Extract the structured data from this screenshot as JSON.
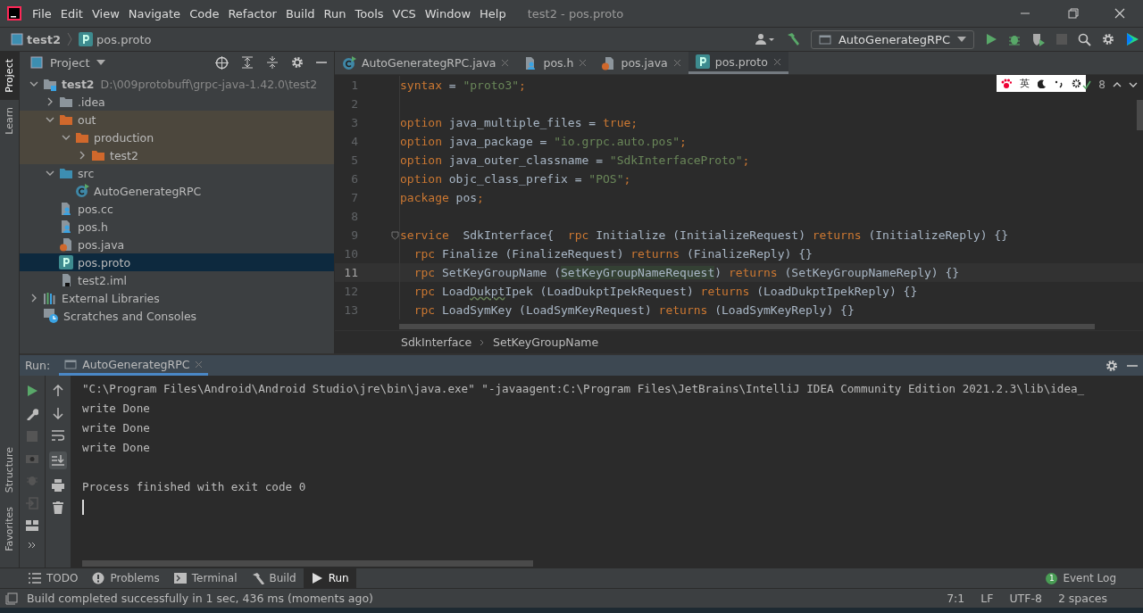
{
  "menu_bar": {
    "items": [
      "File",
      "Edit",
      "View",
      "Navigate",
      "Code",
      "Refactor",
      "Build",
      "Run",
      "Tools",
      "VCS",
      "Window",
      "Help"
    ],
    "title": "test2 - pos.proto"
  },
  "nav_bar": {
    "breadcrumbs": [
      {
        "label": "test2",
        "kind": "project"
      },
      {
        "label": "pos.proto",
        "kind": "proto"
      }
    ],
    "run_config": "AutoGenerategRPC"
  },
  "left_stripe": [
    {
      "label": "Project",
      "selected": true
    },
    {
      "label": "Learn",
      "selected": false
    }
  ],
  "left_stripe_bottom": [
    {
      "label": "Structure"
    },
    {
      "label": "Favorites"
    }
  ],
  "project_panel": {
    "title": "Project",
    "tree": [
      {
        "label": "test2",
        "path": "D:\\009protobuff\\grpc-java-1.42.0\\test2",
        "kind": "module",
        "expanded": true,
        "selected": false,
        "children": [
          {
            "label": ".idea",
            "kind": "folder",
            "expanded": false,
            "selected": false
          },
          {
            "label": "out",
            "kind": "excluded",
            "expanded": true,
            "selected": false,
            "children": [
              {
                "label": "production",
                "kind": "excluded",
                "expanded": true,
                "selected": false,
                "children": [
                  {
                    "label": "test2",
                    "kind": "excluded",
                    "expanded": false,
                    "selected": false
                  }
                ]
              }
            ]
          },
          {
            "label": "src",
            "kind": "source",
            "expanded": true,
            "selected": false,
            "children": [
              {
                "label": "AutoGenerategRPC",
                "kind": "class",
                "selected": false
              }
            ]
          },
          {
            "label": "pos.cc",
            "kind": "cpp",
            "selected": false
          },
          {
            "label": "pos.h",
            "kind": "cpp",
            "selected": false
          },
          {
            "label": "pos.java",
            "kind": "java",
            "selected": false
          },
          {
            "label": "pos.proto",
            "kind": "proto",
            "selected": true
          },
          {
            "label": "test2.iml",
            "kind": "iml",
            "selected": false
          }
        ]
      },
      {
        "label": "External Libraries",
        "kind": "libraries",
        "expanded": false,
        "selected": false
      },
      {
        "label": "Scratches and Consoles",
        "kind": "scratches",
        "selected": false
      }
    ]
  },
  "editor": {
    "tabs": [
      {
        "label": "AutoGenerategRPC.java",
        "kind": "class",
        "selected": false
      },
      {
        "label": "pos.h",
        "kind": "cpp",
        "selected": false
      },
      {
        "label": "pos.java",
        "kind": "java",
        "selected": false
      },
      {
        "label": "pos.proto",
        "kind": "proto",
        "selected": true
      }
    ],
    "ime_bar": {
      "label": "英"
    },
    "inspection_count": "8",
    "lines": [
      {
        "number": "1",
        "current": false,
        "tokens": [
          {
            "kind": "keyword",
            "text": "syntax"
          },
          {
            "kind": "plain",
            "text": " = "
          },
          {
            "kind": "string",
            "text": "\"proto3\""
          },
          {
            "kind": "keyword",
            "text": ";"
          }
        ]
      },
      {
        "number": "2",
        "current": false
      },
      {
        "number": "3",
        "current": false,
        "tokens": [
          {
            "kind": "keyword",
            "text": "option"
          },
          {
            "kind": "plain",
            "text": " java_multiple_files = "
          },
          {
            "kind": "keyword",
            "text": "true;"
          }
        ]
      },
      {
        "number": "4",
        "current": false,
        "tokens": [
          {
            "kind": "keyword",
            "text": "option"
          },
          {
            "kind": "plain",
            "text": " java_package = "
          },
          {
            "kind": "string",
            "text": "\"io.grpc.auto.pos\""
          },
          {
            "kind": "keyword",
            "text": ";"
          }
        ]
      },
      {
        "number": "5",
        "current": false,
        "tokens": [
          {
            "kind": "keyword",
            "text": "option"
          },
          {
            "kind": "plain",
            "text": " java_outer_classname = "
          },
          {
            "kind": "string",
            "text": "\"SdkInterfaceProto\""
          },
          {
            "kind": "keyword",
            "text": ";"
          }
        ]
      },
      {
        "number": "6",
        "current": false,
        "tokens": [
          {
            "kind": "keyword",
            "text": "option"
          },
          {
            "kind": "plain",
            "text": " objc_class_prefix = "
          },
          {
            "kind": "string",
            "text": "\"POS\""
          },
          {
            "kind": "keyword",
            "text": ";"
          }
        ]
      },
      {
        "number": "7",
        "current": false,
        "tokens": [
          {
            "kind": "keyword",
            "text": "package"
          },
          {
            "kind": "plain",
            "text": " pos"
          },
          {
            "kind": "keyword",
            "text": ";"
          }
        ]
      },
      {
        "number": "8",
        "current": false
      },
      {
        "number": "9",
        "current": false,
        "tokens": [
          {
            "kind": "keyword",
            "text": "service"
          },
          {
            "kind": "plain",
            "text": "  SdkInterface{  "
          },
          {
            "kind": "keyword",
            "text": "rpc"
          },
          {
            "kind": "plain",
            "text": " Initialize (InitializeRequest) "
          },
          {
            "kind": "keyword",
            "text": "returns"
          },
          {
            "kind": "plain",
            "text": " (InitializeReply) {}"
          }
        ]
      },
      {
        "number": "10",
        "current": false,
        "tokens": [
          {
            "kind": "keyword",
            "text": "  rpc"
          },
          {
            "kind": "plain",
            "text": " Finalize (FinalizeRequest) "
          },
          {
            "kind": "keyword",
            "text": "returns"
          },
          {
            "kind": "plain",
            "text": " (FinalizeReply) {}"
          }
        ]
      },
      {
        "number": "11",
        "current": true,
        "tokens": [
          {
            "kind": "keyword",
            "text": "  rpc"
          },
          {
            "kind": "plain",
            "text": " SetKeyGroupName ("
          },
          {
            "kind": "highlight",
            "text": "SetKeyGroupNameRequest"
          },
          {
            "kind": "plain",
            "text": ") "
          },
          {
            "kind": "keyword",
            "text": "returns"
          },
          {
            "kind": "plain",
            "text": " (SetKeyGroupNameReply) {}"
          }
        ]
      },
      {
        "number": "12",
        "current": false,
        "tokens": [
          {
            "kind": "keyword",
            "text": "  rpc"
          },
          {
            "kind": "plain",
            "text": " Load"
          },
          {
            "kind": "typo",
            "text": "Dukpt"
          },
          {
            "kind": "plain",
            "text": "Ipek (LoadDukptIpekRequest) "
          },
          {
            "kind": "keyword",
            "text": "returns"
          },
          {
            "kind": "plain",
            "text": " (LoadDukptIpekReply) {}"
          }
        ]
      },
      {
        "number": "13",
        "current": false,
        "tokens": [
          {
            "kind": "keyword",
            "text": "  rpc"
          },
          {
            "kind": "plain",
            "text": " LoadSymKey (LoadSymKeyRequest) "
          },
          {
            "kind": "keyword",
            "text": "returns"
          },
          {
            "kind": "plain",
            "text": " (LoadSymKeyReply) {}"
          }
        ]
      }
    ],
    "breadcrumbs": [
      "SdkInterface",
      "SetKeyGroupName"
    ]
  },
  "run_panel": {
    "label": "Run:",
    "tabs": [
      {
        "label": "AutoGenerategRPC",
        "selected": true
      }
    ],
    "output": [
      {
        "text": "\"C:\\Program Files\\Android\\Android Studio\\jre\\bin\\java.exe\" \"-javaagent:C:\\Program Files\\JetBrains\\IntelliJ IDEA Community Edition 2021.2.3\\lib\\idea_",
        "blank_line_before": false
      },
      {
        "text": "write Done",
        "blank_line_before": false
      },
      {
        "text": "write Done",
        "blank_line_before": false
      },
      {
        "text": "write Done",
        "blank_line_before": false
      },
      {
        "text": "Process finished with exit code 0",
        "blank_line_before": true
      }
    ]
  },
  "tool_tabs": [
    {
      "label": "TODO",
      "kind": "list",
      "selected": false
    },
    {
      "label": "Problems",
      "kind": "problems",
      "selected": false
    },
    {
      "label": "Terminal",
      "kind": "terminal",
      "selected": false
    },
    {
      "label": "Build",
      "kind": "hammer",
      "selected": false
    },
    {
      "label": "Run",
      "kind": "run",
      "selected": true
    }
  ],
  "event_log": {
    "label": "Event Log",
    "count": "1"
  },
  "status_bar": {
    "message": "Build completed successfully in 1 sec, 436 ms (moments ago)",
    "items": [
      "7:1",
      "LF",
      "UTF-8",
      "2 spaces"
    ]
  }
}
